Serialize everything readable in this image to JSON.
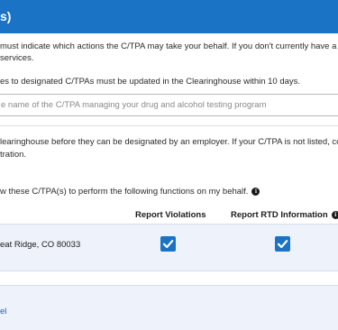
{
  "header": {
    "title": "s)"
  },
  "intro": {
    "line1": "must indicate which actions the C/TPA may take your behalf. If you don't currently have a C/",
    "line2": "services."
  },
  "update_notice": "es to designated C/TPAs must be updated in the Clearinghouse within 10 days.",
  "search": {
    "placeholder": "e name of the C/TPA managing your drug and alcohol testing program"
  },
  "registration": {
    "line1": "learinghouse before they can be designated by an employer. If your C/TPA is not listed, con",
    "line2": "tration."
  },
  "permission_prompt": "w these C/TPA(s) to perform the following functions on my behalf.",
  "columns": {
    "report_violations": "Report Violations",
    "report_rtd": "Report RTD Information"
  },
  "row": {
    "address": "eat Ridge, CO 80033",
    "report_violations_checked": true,
    "report_rtd_checked": true
  },
  "footer": {
    "link_label": "el"
  },
  "colors": {
    "primary": "#1a73c4",
    "row_bg": "#eef3fb"
  }
}
